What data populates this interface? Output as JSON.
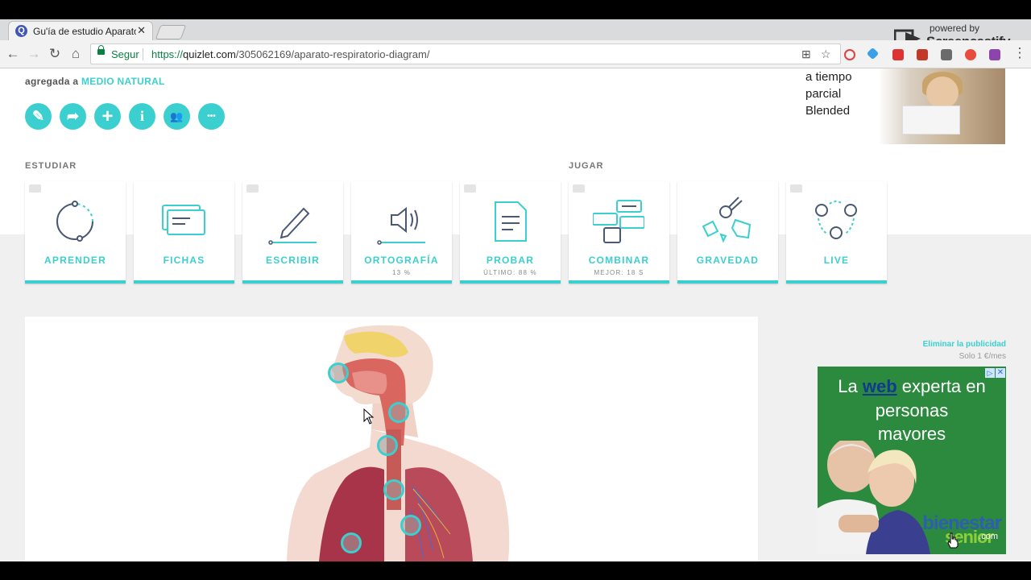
{
  "browser": {
    "tab_title": "Gu'ía de estudio Aparato",
    "tab_close": "✕",
    "secure_label": "Segur",
    "url_scheme": "https://",
    "url_host": "quizlet.com",
    "url_path": "/305062169/aparato-respiratorio-diagram/"
  },
  "screencastify": {
    "powered_by": "powered by",
    "name": "Screencastify"
  },
  "header": {
    "added_prefix": "agregada a",
    "added_link": "MEDIO NATURAL"
  },
  "action_buttons": [
    {
      "name": "edit",
      "icon": "pencil-icon",
      "glyph": "✎"
    },
    {
      "name": "share",
      "icon": "share-icon",
      "glyph": "➦"
    },
    {
      "name": "add",
      "icon": "plus-icon",
      "glyph": "+"
    },
    {
      "name": "info",
      "icon": "info-icon",
      "glyph": "i"
    },
    {
      "name": "people",
      "icon": "people-icon",
      "glyph": "👥"
    },
    {
      "name": "more",
      "icon": "ellipsis-icon",
      "glyph": "•••"
    }
  ],
  "sections": {
    "study": "ESTUDIAR",
    "play": "JUGAR"
  },
  "modes": [
    {
      "label": "APRENDER",
      "sub": ""
    },
    {
      "label": "FICHAS",
      "sub": ""
    },
    {
      "label": "ESCRIBIR",
      "sub": ""
    },
    {
      "label": "ORTOGRAFÍA",
      "sub": "13 %"
    },
    {
      "label": "PROBAR",
      "sub": "ÚLTIMO: 88 %"
    },
    {
      "label": "COMBINAR",
      "sub": "MEJOR: 18 S"
    },
    {
      "label": "GRAVEDAD",
      "sub": ""
    },
    {
      "label": "LIVE",
      "sub": ""
    }
  ],
  "ad_top": {
    "line1": "a tiempo",
    "line2": "parcial",
    "line3": "Blended"
  },
  "ad_side": {
    "remove_label": "Eliminar la publicidad",
    "price": "Solo 1 €/mes",
    "line1_prefix": "La",
    "line1_web": "web",
    "line1_suffix": "experta en",
    "line2": "personas",
    "line3": "mayores",
    "logo_top": "bienestar",
    "logo_bottom": "senior",
    "logo_domain": ".com"
  },
  "colors": {
    "accent": "#3ccfcf",
    "secure": "#0b8043",
    "banner_green": "#2c8a3f"
  }
}
